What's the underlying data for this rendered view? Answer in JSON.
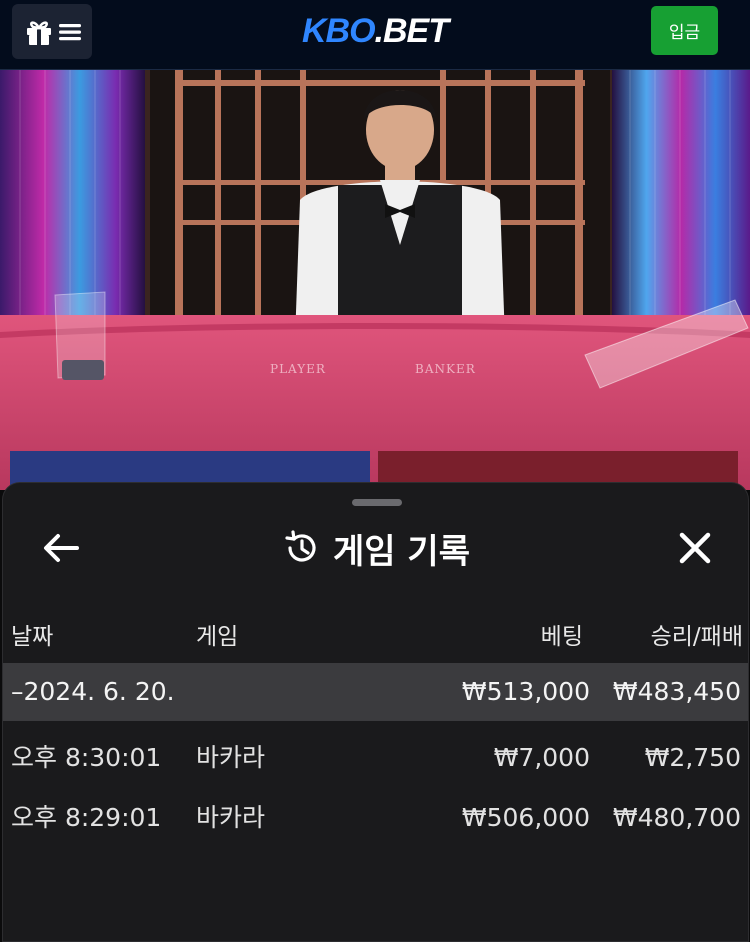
{
  "header": {
    "logo_part1": "KBO",
    "logo_dot": ".",
    "logo_part2": "BET",
    "deposit_label": "입금",
    "menu_icon": "gift-menu-icon",
    "colors": {
      "logo_blue": "#2f86ff",
      "deposit_green": "#17a033"
    }
  },
  "scene": {
    "table_label_player": "PLAYER",
    "table_label_banker": "BANKER"
  },
  "history_sheet": {
    "title": "게임 기록",
    "title_icon": "history-icon",
    "back_icon": "arrow-left-icon",
    "close_icon": "close-icon",
    "columns": {
      "date": "날짜",
      "game": "게임",
      "bet": "베팅",
      "win_loss": "승리/패배"
    },
    "summary": {
      "date": "–2024. 6. 20.",
      "bet": "₩513,000",
      "win_loss": "₩483,450"
    },
    "rows": [
      {
        "time": "오후 8:30:01",
        "game": "바카라",
        "bet": "₩7,000",
        "win_loss": "₩2,750"
      },
      {
        "time": "오후 8:29:01",
        "game": "바카라",
        "bet": "₩506,000",
        "win_loss": "₩480,700"
      }
    ]
  }
}
